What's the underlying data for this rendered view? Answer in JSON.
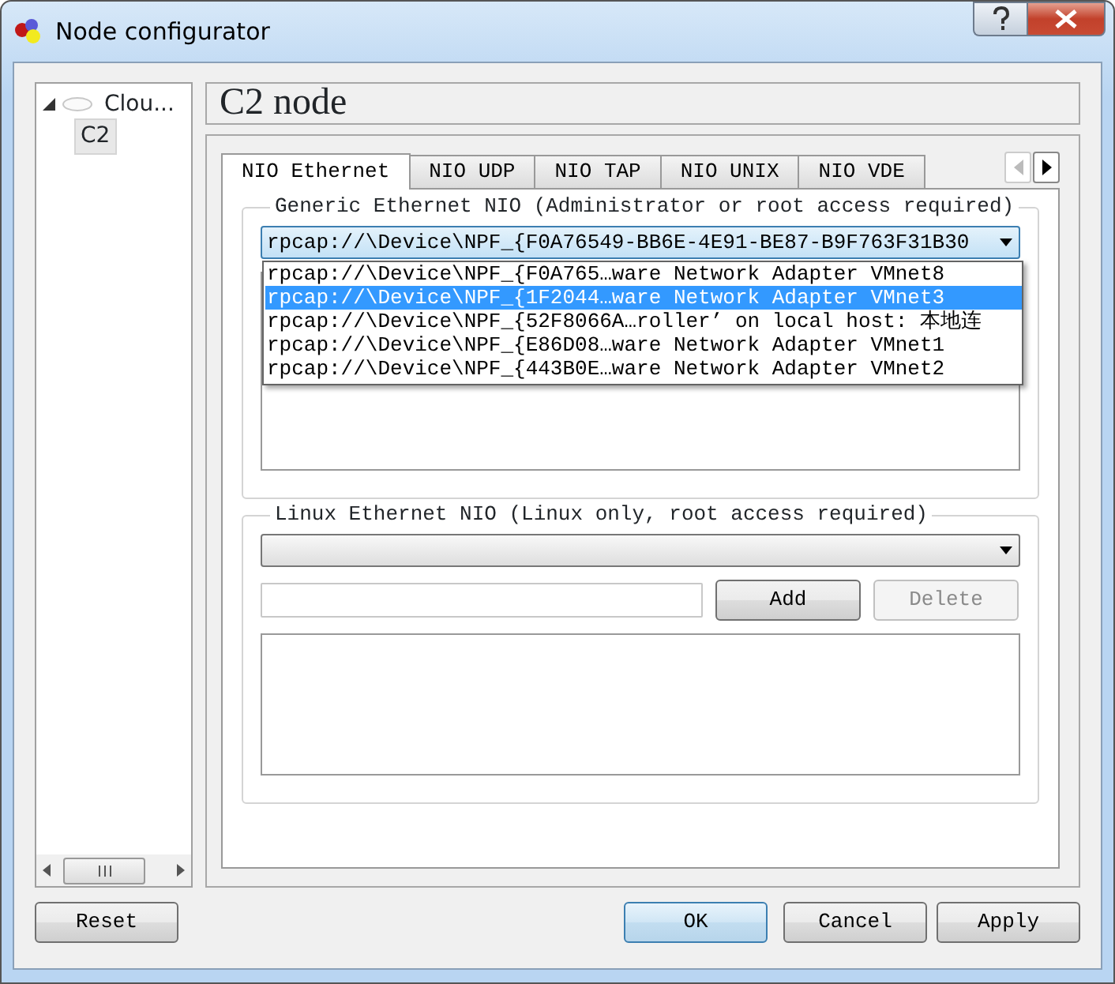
{
  "window": {
    "title": "Node configurator"
  },
  "node_tree": [
    {
      "label": "Clou...",
      "expanded": true,
      "selected": false,
      "children": [
        {
          "label": "C2",
          "selected": true
        }
      ]
    }
  ],
  "page_title": "C2 node",
  "tabs": [
    {
      "label": "NIO Ethernet",
      "selected": true
    },
    {
      "label": "NIO UDP",
      "selected": false
    },
    {
      "label": "NIO TAP",
      "selected": false
    },
    {
      "label": "NIO UNIX",
      "selected": false
    },
    {
      "label": "NIO VDE",
      "selected": false
    }
  ],
  "tab_scroll_buttons": [
    {
      "kind": "left",
      "disabled": true
    },
    {
      "kind": "right",
      "disabled": false
    }
  ],
  "generic_ethernet": {
    "title": "Generic Ethernet NIO (Administrator or root access required)",
    "combo": {
      "value": "rpcap://\\Device\\NPF_{F0A76549-BB6E-4E91-BE87-B9F763F31B30",
      "expanded": true
    },
    "dropdown_items": [
      {
        "text": "rpcap://\\Device\\NPF_{F0A765…ware Network Adapter VMnet8",
        "selected": false
      },
      {
        "text": "rpcap://\\Device\\NPF_{1F2044…ware Network Adapter VMnet3",
        "selected": true
      },
      {
        "text": "rpcap://\\Device\\NPF_{52F8066A…roller’ on local host: 本地连",
        "selected": false
      },
      {
        "text": "rpcap://\\Device\\NPF_{E86D08…ware Network Adapter VMnet1",
        "selected": false
      },
      {
        "text": "rpcap://\\Device\\NPF_{443B0E…ware Network Adapter VMnet2",
        "selected": false
      }
    ]
  },
  "linux_ethernet": {
    "title": "Linux Ethernet NIO (Linux only, root access required)",
    "buttons": [
      {
        "label": "Add",
        "disabled": false
      },
      {
        "label": "Delete",
        "disabled": true
      }
    ]
  },
  "footer_buttons": [
    {
      "label": "Reset",
      "default": false
    },
    {
      "label": "OK",
      "default": true
    },
    {
      "label": "Cancel",
      "default": false
    },
    {
      "label": "Apply",
      "default": false
    }
  ]
}
